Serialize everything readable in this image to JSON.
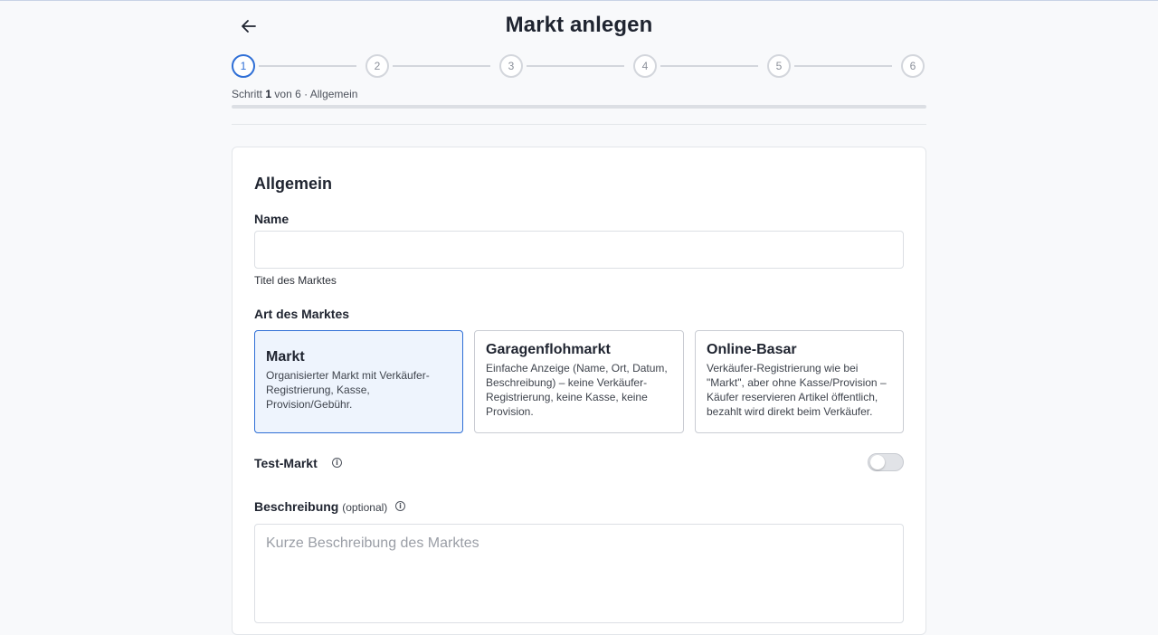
{
  "header": {
    "title": "Markt anlegen",
    "back_icon": "arrow-left-icon"
  },
  "stepper": {
    "steps": [
      "1",
      "2",
      "3",
      "4",
      "5",
      "6"
    ],
    "current_step": 1,
    "info_prefix": "Schritt",
    "info_current": "1",
    "info_suffix": "von 6 · Allgemein",
    "progress_fraction": 0.0
  },
  "form": {
    "section_title": "Allgemein",
    "name": {
      "label": "Name",
      "value": "",
      "hint": "Titel des Marktes"
    },
    "market_type": {
      "label": "Art des Marktes",
      "selected": "Markt",
      "options": [
        {
          "title": "Markt",
          "description": "Organisierter Markt mit Verkäufer-Registrierung, Kasse, Provision/Gebühr."
        },
        {
          "title": "Garagenflohmarkt",
          "description": "Einfache Anzeige (Name, Ort, Datum, Beschreibung) – keine Verkäufer-Registrierung, keine Kasse, keine Provision."
        },
        {
          "title": "Online-Basar",
          "description": "Verkäufer-Registrierung wie bei \"Markt\", aber ohne Kasse/Provision – Käufer reservieren Artikel öffentlich, bezahlt wird direkt beim Verkäufer."
        }
      ]
    },
    "test_market": {
      "label": "Test-Markt",
      "info_icon": "info-icon",
      "enabled": false
    },
    "description": {
      "label": "Beschreibung",
      "optional": "(optional)",
      "info_icon": "info-icon",
      "placeholder": "Kurze Beschreibung des Marktes",
      "value": ""
    }
  },
  "colors": {
    "accent": "#2f6fd6",
    "selected_bg": "#eef4fd",
    "page_bg": "#f8f9fb"
  }
}
